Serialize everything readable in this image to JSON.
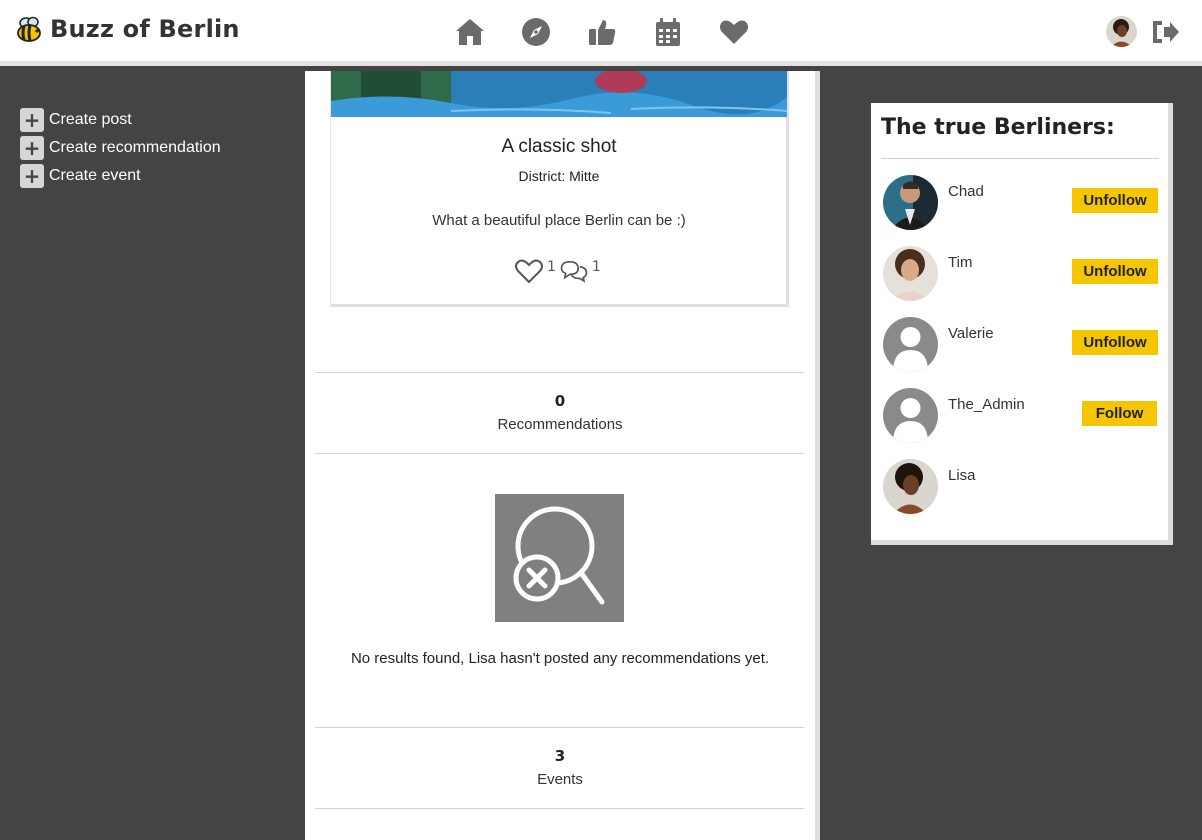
{
  "nav": {
    "brand_title": "Buzz of Berlin",
    "icons": [
      "home-icon",
      "compass-icon",
      "thumbs-up-icon",
      "calendar-icon",
      "heart-icon"
    ],
    "signout_icon": "sign-out-icon"
  },
  "sidebar": {
    "items": [
      {
        "label": "Create post"
      },
      {
        "label": "Create recommendation"
      },
      {
        "label": "Create event"
      }
    ]
  },
  "post": {
    "title": "A classic shot",
    "district": "District: Mitte",
    "content": "What a beautiful place Berlin can be :)",
    "likes": "1",
    "comments": "1"
  },
  "stats": {
    "recommendations_count": "0",
    "recommendations_label": "Recommendations",
    "events_count": "3",
    "events_label": "Events"
  },
  "no_results": {
    "text": "No results found, Lisa hasn't posted any recommendations yet."
  },
  "profiles_panel": {
    "title": "The true Berliners:",
    "profiles": [
      {
        "name": "Chad",
        "button": "Unfollow"
      },
      {
        "name": "Tim",
        "button": "Unfollow"
      },
      {
        "name": "Valerie",
        "button": "Unfollow"
      },
      {
        "name": "The_Admin",
        "button": "Follow"
      },
      {
        "name": "Lisa",
        "button": ""
      }
    ]
  },
  "colors": {
    "background": "#444444",
    "accent": "#f5c500",
    "icon_gray": "#6b6b6b"
  }
}
